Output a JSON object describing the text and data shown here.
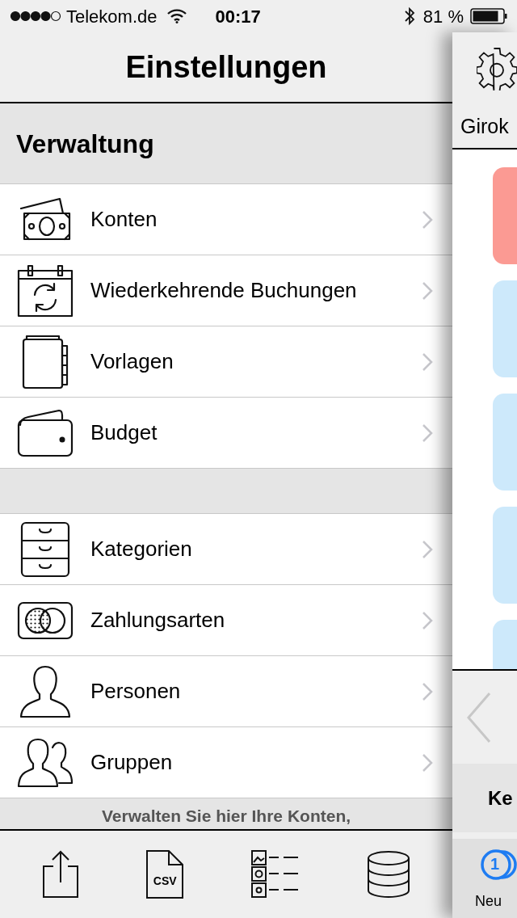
{
  "status_bar": {
    "carrier": "Telekom.de",
    "time": "00:17",
    "battery": "81 %"
  },
  "nav": {
    "title": "Einstellungen"
  },
  "section": {
    "title": "Verwaltung"
  },
  "groups": [
    [
      {
        "label": "Konten"
      },
      {
        "label": "Wiederkehrende Buchungen"
      },
      {
        "label": "Vorlagen"
      },
      {
        "label": "Budget"
      }
    ],
    [
      {
        "label": "Kategorien"
      },
      {
        "label": "Zahlungsarten"
      },
      {
        "label": "Personen"
      },
      {
        "label": "Gruppen"
      }
    ]
  ],
  "footer_text": "Verwalten Sie hier Ihre Konten,",
  "toolbar": {
    "csv_label": "CSV"
  },
  "side_panel": {
    "account_title": "Girok",
    "cards": [
      {
        "color": "#fb9a93"
      },
      {
        "color": "#cde9fb"
      },
      {
        "color": "#cde9fb"
      },
      {
        "color": "#cde9fb"
      },
      {
        "color": "#cde9fb"
      }
    ],
    "section_label": "Ke",
    "coin_number": "1",
    "tab_label": "Neu"
  }
}
